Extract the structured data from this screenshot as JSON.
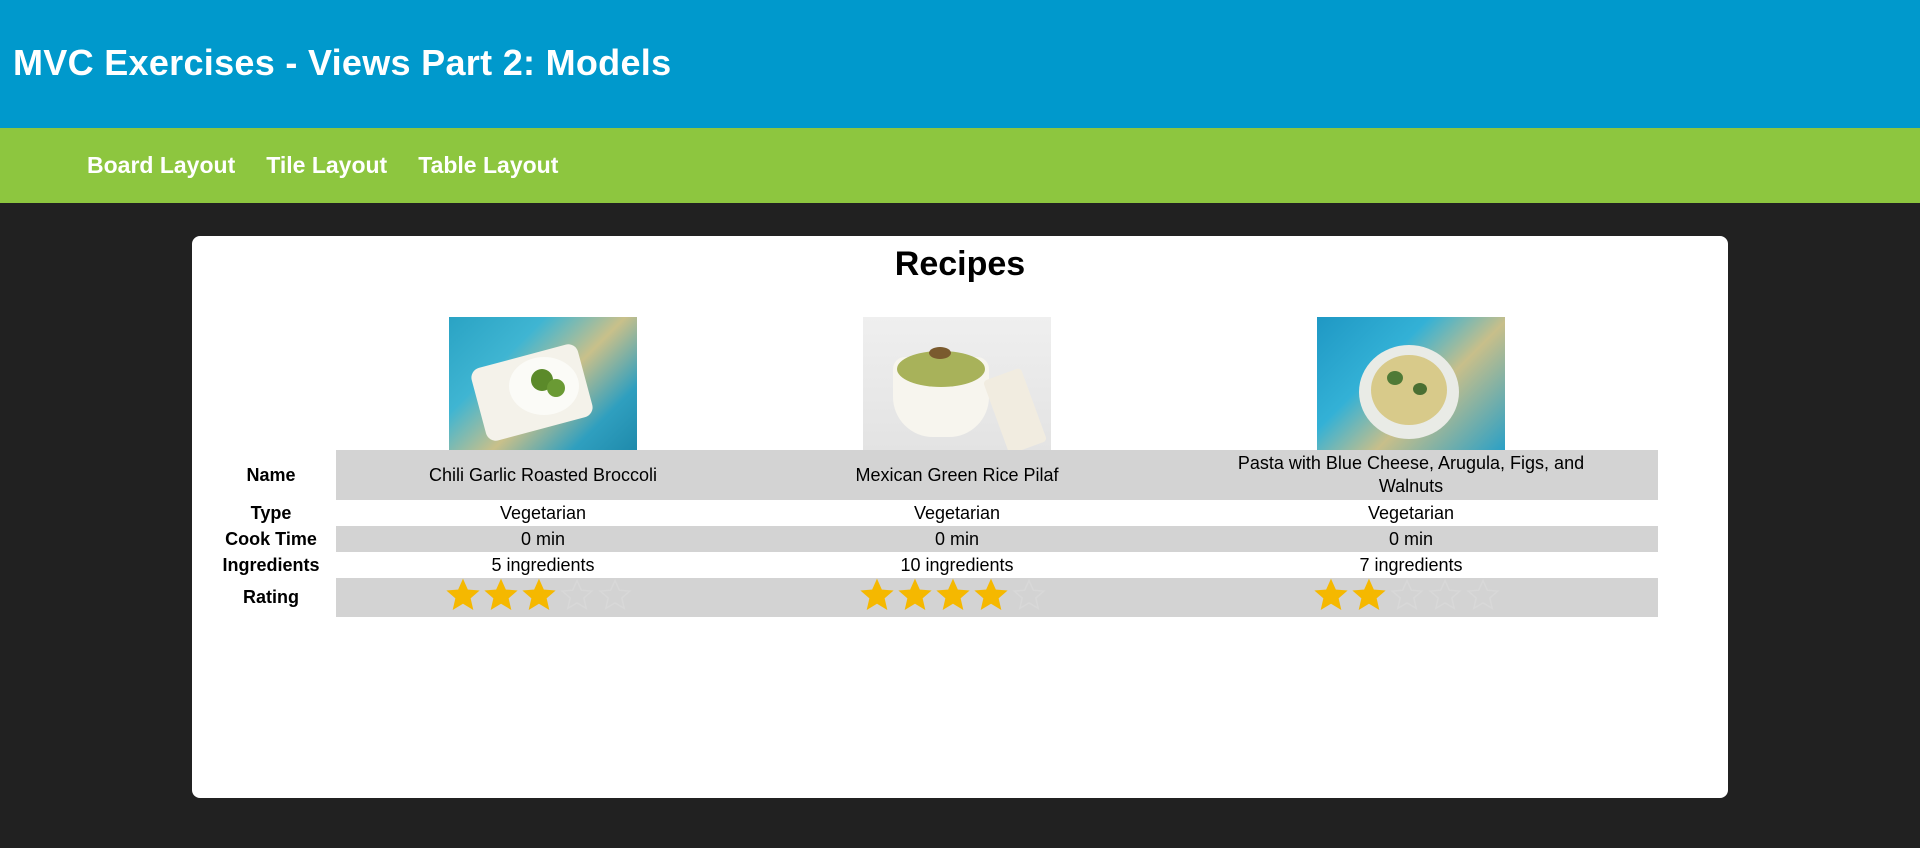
{
  "header": {
    "title": "MVC Exercises - Views Part 2: Models"
  },
  "nav": [
    {
      "label": "Board Layout"
    },
    {
      "label": "Tile Layout"
    },
    {
      "label": "Table Layout"
    }
  ],
  "main": {
    "title": "Recipes",
    "row_labels": {
      "name": "Name",
      "type": "Type",
      "cook_time": "Cook Time",
      "ingredients": "Ingredients",
      "rating": "Rating"
    },
    "recipes": [
      {
        "name": "Chili Garlic Roasted Broccoli",
        "type": "Vegetarian",
        "cook_time": "0 min",
        "ingredients": "5 ingredients",
        "rating": 3,
        "image": "recipe-photo-broccoli"
      },
      {
        "name": "Mexican Green Rice Pilaf",
        "type": "Vegetarian",
        "cook_time": "0 min",
        "ingredients": "10 ingredients",
        "rating": 4,
        "image": "recipe-photo-rice-pilaf"
      },
      {
        "name": "Pasta with Blue Cheese, Arugula, Figs, and Walnuts",
        "type": "Vegetarian",
        "cook_time": "0 min",
        "ingredients": "7 ingredients",
        "rating": 2,
        "image": "recipe-photo-pasta"
      }
    ],
    "rating_max": 5
  },
  "colors": {
    "header_bg": "#0099cc",
    "nav_bg": "#8dc63f",
    "page_bg": "#212121",
    "row_highlight": "#d3d3d3",
    "star_filled": "#f5b800",
    "star_empty": "#d8d8d8"
  }
}
